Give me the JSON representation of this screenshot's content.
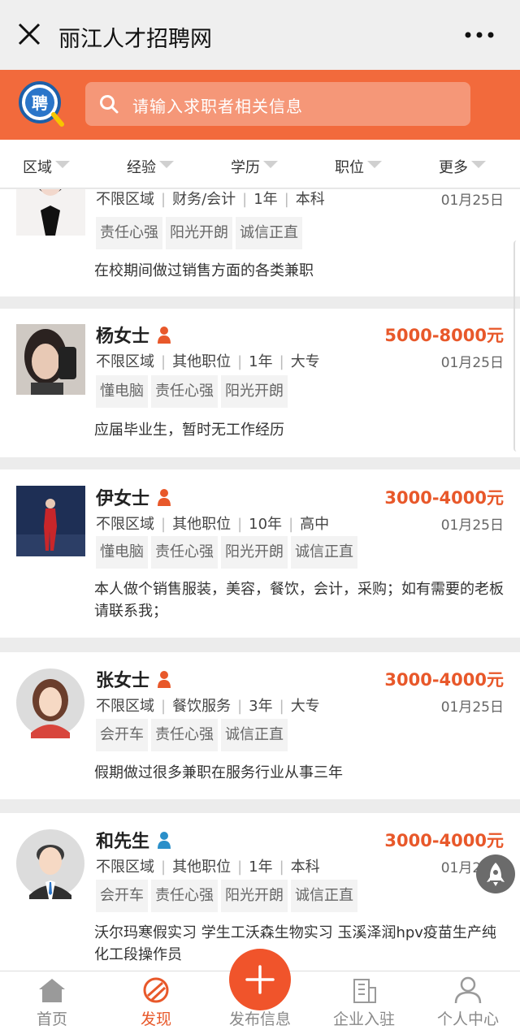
{
  "window": {
    "title": "丽江人才招聘网",
    "close_icon": "close-icon",
    "more_icon": "more-dots-icon"
  },
  "search": {
    "logo_text": "聘",
    "placeholder": "请输入求职者相关信息"
  },
  "filters": [
    "区域",
    "经验",
    "学历",
    "职位",
    "更多"
  ],
  "cards": [
    {
      "name": "",
      "salary": "",
      "region": "不限区域",
      "category": "财务/会计",
      "experience": "1年",
      "education": "本科",
      "date": "01月25日",
      "tags": [
        "责任心强",
        "阳光开朗",
        "诚信正直"
      ],
      "description": "在校期间做过销售方面的各类兼职",
      "gender": "female"
    },
    {
      "name": "杨女士",
      "salary": "5000-8000元",
      "region": "不限区域",
      "category": "其他职位",
      "experience": "1年",
      "education": "大专",
      "date": "01月25日",
      "tags": [
        "懂电脑",
        "责任心强",
        "阳光开朗"
      ],
      "description": "应届毕业生，暂时无工作经历",
      "gender": "female"
    },
    {
      "name": "伊女士",
      "salary": "3000-4000元",
      "region": "不限区域",
      "category": "其他职位",
      "experience": "10年",
      "education": "高中",
      "date": "01月25日",
      "tags": [
        "懂电脑",
        "责任心强",
        "阳光开朗",
        "诚信正直"
      ],
      "description": "本人做个销售服装，美容，餐饮，会计，采购；如有需要的老板请联系我；",
      "gender": "female"
    },
    {
      "name": "张女士",
      "salary": "3000-4000元",
      "region": "不限区域",
      "category": "餐饮服务",
      "experience": "3年",
      "education": "大专",
      "date": "01月25日",
      "tags": [
        "会开车",
        "责任心强",
        "诚信正直"
      ],
      "description": "假期做过很多兼职在服务行业从事三年",
      "gender": "female"
    },
    {
      "name": "和先生",
      "salary": "3000-4000元",
      "region": "不限区域",
      "category": "其他职位",
      "experience": "1年",
      "education": "本科",
      "date": "01月25日",
      "tags": [
        "会开车",
        "责任心强",
        "阳光开朗",
        "诚信正直"
      ],
      "description": "沃尔玛寒假实习 学生工沃森生物实习 玉溪泽润hpv疫苗生产纯化工段操作员",
      "gender": "male"
    }
  ],
  "tabbar": {
    "home": "首页",
    "discover": "发现",
    "post": "发布信息",
    "company": "企业入驻",
    "profile": "个人中心"
  },
  "colors": {
    "brand": "#f26a3c",
    "salary": "#e8582a",
    "tab_active": "#e8582a"
  }
}
